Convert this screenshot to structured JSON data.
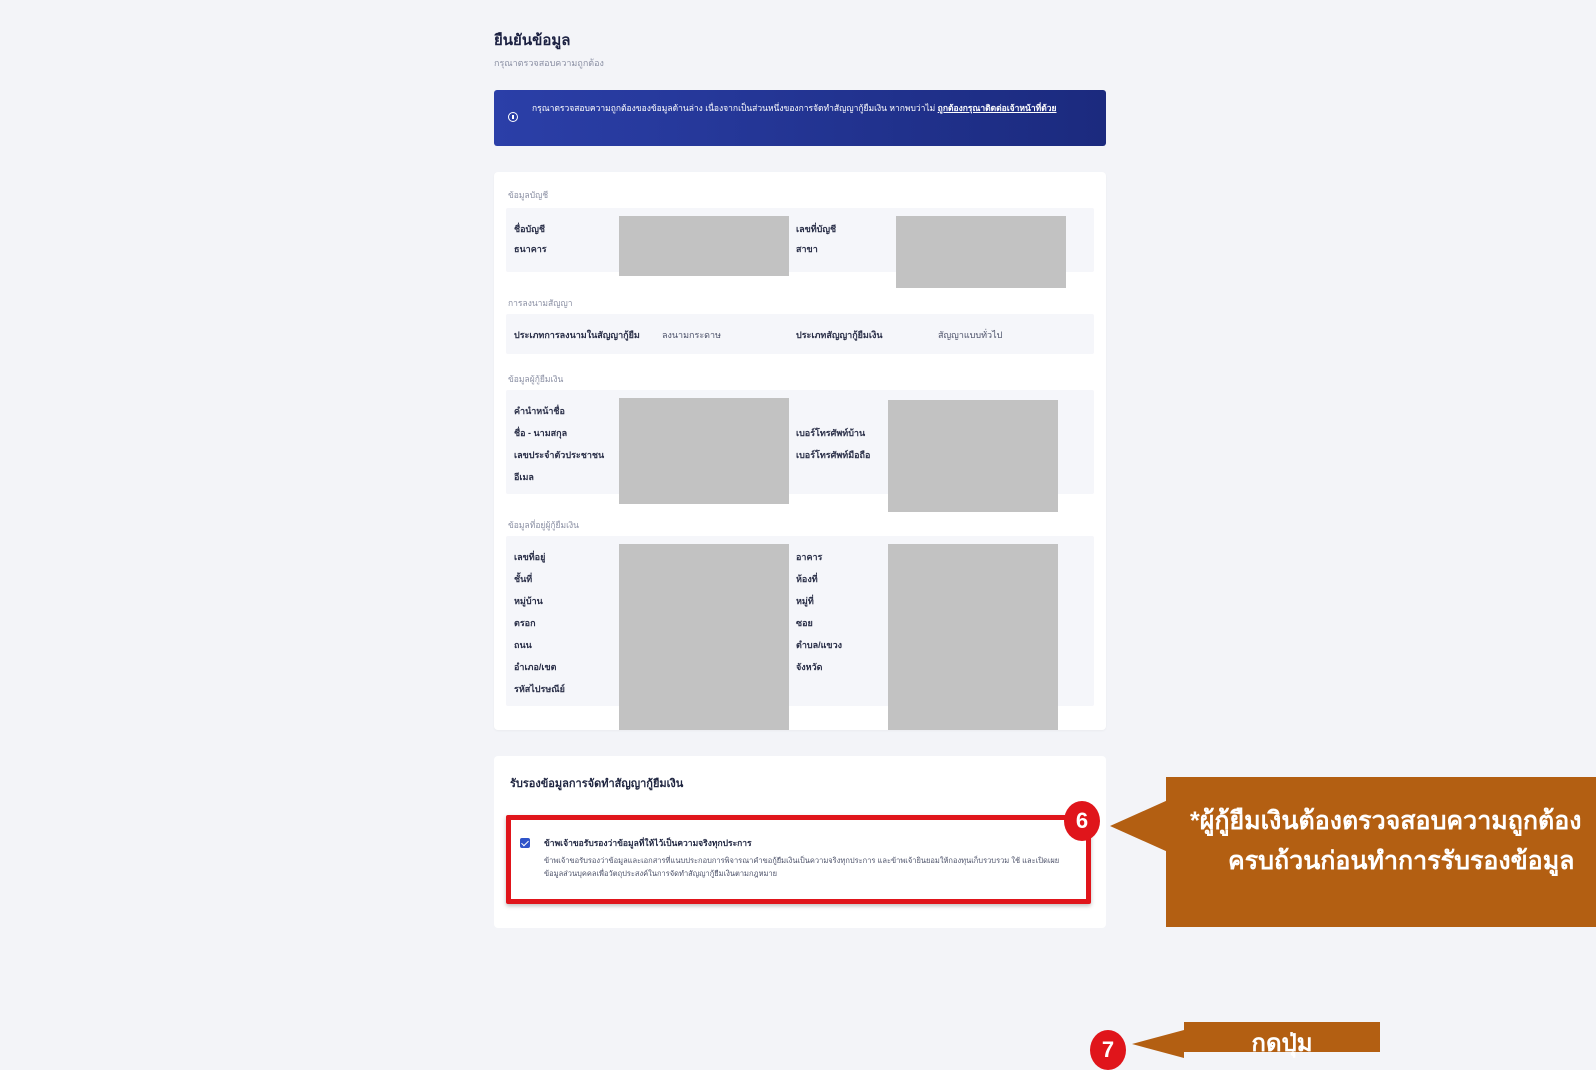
{
  "page": {
    "title": "ยืนยันข้อมูล",
    "subtitle": "กรุณาตรวจสอบความถูกต้อง"
  },
  "notice": {
    "text": "กรุณาตรวจสอบความถูกต้องของข้อมูลด้านล่าง เนื่องจากเป็นส่วนหนึ่งของการจัดทำสัญญากู้ยืมเงิน หากพบว่าไม่",
    "link": "ถูกต้องกรุณาติดต่อเจ้าหน้าที่ด้วย"
  },
  "sections": {
    "account": {
      "label": "ข้อมูลบัญชี",
      "left_labels": [
        "ชื่อบัญชี",
        "ธนาคาร"
      ],
      "right_labels": [
        "เลขที่บัญชี",
        "สาขา"
      ]
    },
    "contract": {
      "label": "การลงนามสัญญา",
      "left_label": "ประเภทการลงนามในสัญญากู้ยืม",
      "left_value": "ลงนามกระดาษ",
      "right_label": "ประเภทสัญญากู้ยืมเงิน",
      "right_value": "สัญญาแบบทั่วไป"
    },
    "borrower": {
      "label": "ข้อมูลผู้กู้ยืมเงิน",
      "left_labels": [
        "คำนำหน้าชื่อ",
        "ชื่อ - นามสกุล",
        "เลขประจำตัวประชาชน",
        "อีเมล"
      ],
      "right_labels": [
        "เบอร์โทรศัพท์บ้าน",
        "เบอร์โทรศัพท์มือถือ"
      ]
    },
    "address": {
      "label": "ข้อมูลที่อยู่ผู้กู้ยืมเงิน",
      "left_labels": [
        "เลขที่อยู่",
        "ชั้นที่",
        "หมู่บ้าน",
        "ตรอก",
        "ถนน",
        "อำเภอ/เขต",
        "รหัสไปรษณีย์"
      ],
      "right_labels": [
        "อาคาร",
        "ห้องที่",
        "หมู่ที่",
        "ซอย",
        "ตำบล/แขวง",
        "จังหวัด"
      ]
    }
  },
  "confirm": {
    "title": "รับรองข้อมูลการจัดทำสัญญากู้ยืมเงิน",
    "checkbox_label": "ข้าพเจ้าขอรับรองว่าข้อมูลที่ให้ไว้เป็นความจริงทุกประการ",
    "checkbox_checked": true,
    "description": "ข้าพเจ้าขอรับรองว่าข้อมูลและเอกสารที่แนบประกอบการพิจารณาคำขอกู้ยืมเงินเป็นความจริงทุกประการ และข้าพเจ้ายินยอมให้กองทุนเก็บรวบรวม ใช้ และเปิดเผยข้อมูลส่วนบุคคลเพื่อวัตถุประสงค์ในการจัดทำสัญญากู้ยืมเงินตามกฎหมาย"
  },
  "annotations": {
    "step6": "6",
    "step7": "7",
    "callout_line1": "*ผู้กู้ยืมเงินต้องตรวจสอบความถูกต้อง",
    "callout_line2": "ครบถ้วนก่อนทำการรับรองข้อมูล",
    "callout2": "กดปุ่ม",
    "accent_color": "#b35f12",
    "highlight_color": "#e0151b"
  }
}
